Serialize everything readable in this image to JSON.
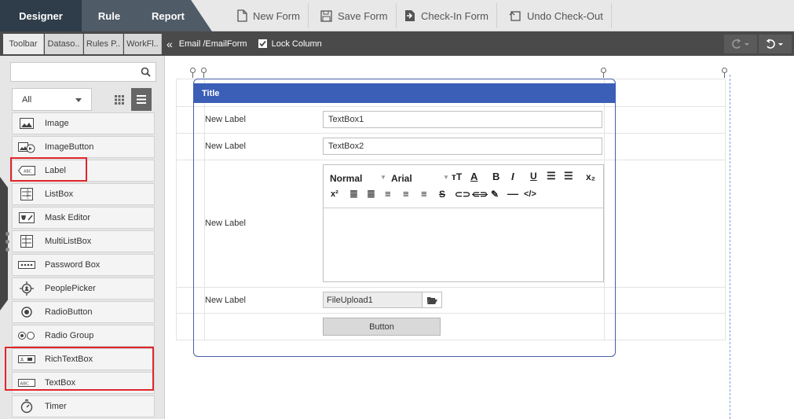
{
  "modes": {
    "designer": "Designer",
    "rule": "Rule",
    "report": "Report"
  },
  "toolbar": {
    "new_form": "New Form",
    "save_form": "Save Form",
    "check_in": "Check-In Form",
    "undo_check_out": "Undo Check-Out"
  },
  "panel_tabs": [
    "Toolbar",
    "Dataso..",
    "Rules P..",
    "WorkFl.."
  ],
  "breadcrumb": {
    "path": "Email /EmailForm",
    "lock_column": "Lock Column"
  },
  "left_panel": {
    "search_placeholder": "",
    "filter_value": "All",
    "items": [
      "Image",
      "ImageButton",
      "Label",
      "ListBox",
      "Mask Editor",
      "MultiListBox",
      "Password Box",
      "PeoplePicker",
      "RadioButton",
      "Radio Group",
      "RichTextBox",
      "TextBox",
      "Timer"
    ]
  },
  "form": {
    "title": "Title",
    "rows": [
      {
        "label": "New Label",
        "control": "TextBox1"
      },
      {
        "label": "New Label",
        "control": "TextBox2"
      },
      {
        "label": "New Label",
        "control": ""
      },
      {
        "label": "New Label",
        "control": "FileUpload1"
      }
    ],
    "rte": {
      "style": "Normal",
      "font": "Arial",
      "sup": "x²",
      "sub": "x₂"
    },
    "button_label": "Button"
  },
  "colors": {
    "dark_tab": "#2f3d4a",
    "title_blue": "#3b5fb6",
    "highlight_red": "#e0262b",
    "subbar": "#4a4a4a"
  }
}
